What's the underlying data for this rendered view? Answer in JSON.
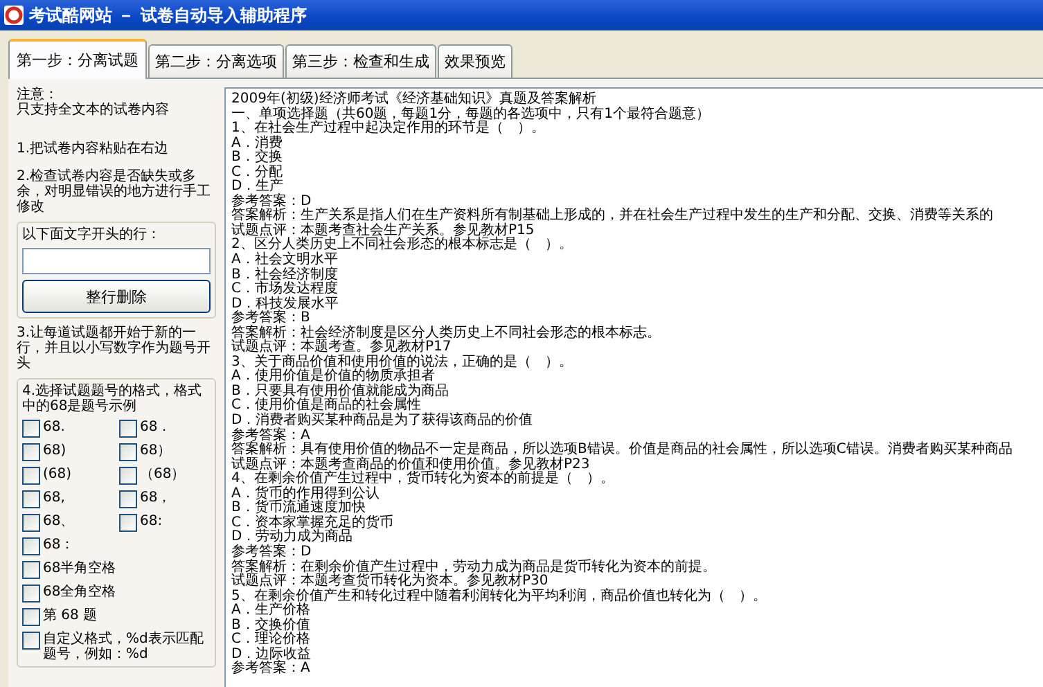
{
  "window": {
    "title": "考试酷网站 － 试卷自动导入辅助程序"
  },
  "tabs": [
    {
      "label": "第一步：分离试题",
      "selected": true
    },
    {
      "label": "第二步：分离选项",
      "selected": false
    },
    {
      "label": "第三步：检查和生成",
      "selected": false
    },
    {
      "label": "效果预览",
      "selected": false
    }
  ],
  "sidebar": {
    "note_title": "注意：",
    "note": "只支持全文本的试卷内容",
    "step_1": "1.把试卷内容粘贴在右边",
    "step_2": "2.检查试卷内容是否缺失或多余，对明显错误的地方进行手工修改",
    "delete_group": {
      "label": "以下面文字开头的行：",
      "button": "整行删除"
    },
    "step_3": "3.让每道试题都开始于新的一行，并且以小写数字作为题号开头",
    "format_group": {
      "label": "4.选择试题题号的格式，格式中的68是题号示例",
      "options": [
        {
          "label": "68.",
          "checked": false
        },
        {
          "label": "68．",
          "checked": false
        },
        {
          "label": "68)",
          "checked": false
        },
        {
          "label": "68）",
          "checked": false
        },
        {
          "label": "(68)",
          "checked": false
        },
        {
          "label": "（68）",
          "checked": false
        },
        {
          "label": "68,",
          "checked": false
        },
        {
          "label": "68，",
          "checked": false
        },
        {
          "label": "68、",
          "checked": false
        },
        {
          "label": "68:",
          "checked": false
        },
        {
          "label": "68：",
          "checked": false
        },
        {
          "label": "68半角空格",
          "checked": false
        },
        {
          "label": "68全角空格",
          "checked": false
        },
        {
          "label": "第 68 题",
          "checked": false
        },
        {
          "label": "自定义格式，%d表示匹配题号，例如：%d",
          "checked": false
        }
      ]
    }
  },
  "editor": {
    "lines": [
      "2009年(初级)经济师考试《经济基础知识》真题及答案解析",
      "一、单项选择题（共60题，每题1分，每题的各选项中，只有1个最符合题意）",
      "1、在社会生产过程中起决定作用的环节是（　）。",
      "A．消费",
      "B．交换",
      "C．分配",
      "D．生产",
      "参考答案：D",
      "答案解析：生产关系是指人们在生产资料所有制基础上形成的，并在社会生产过程中发生的生产和分配、交换、消费等关系的",
      "试题点评：本题考查社会生产关系。参见教材P15",
      "2、区分人类历史上不同社会形态的根本标志是（　）。",
      "A．社会文明水平",
      "B．社会经济制度",
      "C．市场发达程度",
      "D．科技发展水平",
      "参考答案：B",
      "答案解析：社会经济制度是区分人类历史上不同社会形态的根本标志。",
      "试题点评：本题考查。参见教材P17",
      "3、关于商品价值和使用价值的说法，正确的是（　）。",
      "A．使用价值是价值的物质承担者",
      "B．只要具有使用价值就能成为商品",
      "C．使用价值是商品的社会属性",
      "D．消费者购买某种商品是为了获得该商品的价值",
      "参考答案：A",
      "答案解析：具有使用价值的物品不一定是商品，所以选项B错误。价值是商品的社会属性，所以选项C错误。消费者购买某种商品",
      "试题点评：本题考查商品的价值和使用价值。参见教材P23",
      "4、在剩余价值产生过程中，货币转化为资本的前提是（　）。",
      "A．货币的作用得到公认",
      "B．货币流通速度加快",
      "C．资本家掌握充足的货币",
      "D．劳动力成为商品",
      "参考答案：D",
      "答案解析：在剩余价值产生过程中，劳动力成为商品是货币转化为资本的前提。",
      "试题点评：本题考查货币转化为资本。参见教材P30",
      "5、在剩余价值产生和转化过程中随着利润转化为平均利润，商品价值也转化为（　）。",
      "A．生产价格",
      "B．交换价值",
      "C．理论价格",
      "D．边际收益",
      "参考答案：A"
    ]
  }
}
